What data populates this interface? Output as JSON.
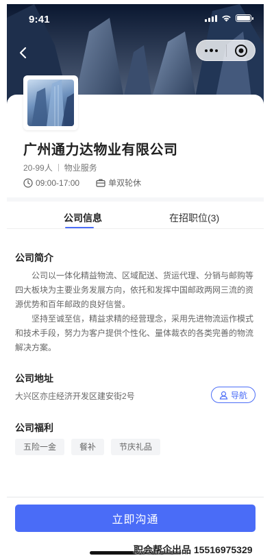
{
  "status_bar": {
    "time": "9:41"
  },
  "company": {
    "name": "广州通力达物业有限公司",
    "size": "20-99人",
    "industry": "物业服务",
    "hours": "09:00-17:00",
    "rest": "单双轮休"
  },
  "tabs": [
    {
      "label": "公司信息",
      "active": true
    },
    {
      "label": "在招职位(3)",
      "active": false
    }
  ],
  "intro": {
    "title": "公司简介",
    "paragraphs": [
      "公司以一体化精益物流、区域配送、货运代理、分销与邮购等四大板块为主要业务发展方向，依托和发挥中国邮政两网三流的资源优势和百年邮政的良好信誉。",
      "坚持至诚至信，精益求精的经营理念，采用先进物流运作模式和技术手段，努力为客户提供个性化、量体裁衣的各类完善的物流解决方案。"
    ]
  },
  "address": {
    "title": "公司地址",
    "text": "大兴区亦庄经济开发区建安街2号",
    "nav_label": "导航"
  },
  "welfare": {
    "title": "公司福利",
    "tags": [
      "五险一金",
      "餐补",
      "节庆礼品"
    ]
  },
  "cta_label": "立即沟通",
  "watermark": "职会帮企出品 15516975329",
  "colors": {
    "accent": "#4a6cf7"
  },
  "icons": [
    "back-icon",
    "more-dots-icon",
    "target-icon",
    "clock-icon",
    "briefcase-icon",
    "location-person-icon"
  ]
}
